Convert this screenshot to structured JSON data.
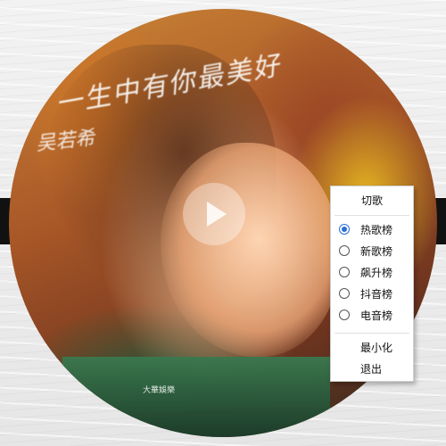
{
  "album": {
    "title_text": "一生中有你最美好",
    "artist_text": "吴若希",
    "logo_text": "大華娛樂"
  },
  "player": {
    "play_icon": "play-icon"
  },
  "context_menu": {
    "header": "切歌",
    "charts": [
      {
        "label": "热歌榜",
        "checked": true
      },
      {
        "label": "新歌榜",
        "checked": false
      },
      {
        "label": "飙升榜",
        "checked": false
      },
      {
        "label": "抖音榜",
        "checked": false
      },
      {
        "label": "电音榜",
        "checked": false
      }
    ],
    "minimize": "最小化",
    "exit": "退出"
  },
  "colors": {
    "accent": "#2b6fd6",
    "menu_bg": "#ffffff"
  }
}
